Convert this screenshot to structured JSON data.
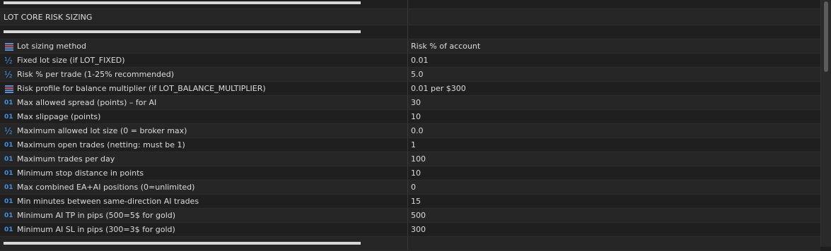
{
  "section": {
    "title": "LOT CORE RISK SIZING"
  },
  "params": [
    {
      "icon": "list-icon",
      "name": "Lot sizing method",
      "value": "Risk % of account"
    },
    {
      "icon": "fraction-icon",
      "name": "Fixed lot size (if LOT_FIXED)",
      "value": "0.01"
    },
    {
      "icon": "fraction-icon",
      "name": "Risk % per trade (1-25% recommended)",
      "value": "5.0"
    },
    {
      "icon": "list-icon",
      "name": "Risk profile for balance multiplier (if LOT_BALANCE_MULTIPLIER)",
      "value": "0.01 per $300"
    },
    {
      "icon": "integer-icon",
      "name": "Max allowed spread (points) – for AI",
      "value": "30"
    },
    {
      "icon": "integer-icon",
      "name": "Max slippage (points)",
      "value": "10"
    },
    {
      "icon": "fraction-icon",
      "name": "Maximum allowed lot size (0 = broker max)",
      "value": "0.0"
    },
    {
      "icon": "integer-icon",
      "name": "Maximum open trades (netting: must be 1)",
      "value": "1"
    },
    {
      "icon": "integer-icon",
      "name": "Maximum trades per day",
      "value": "100"
    },
    {
      "icon": "integer-icon",
      "name": "Minimum stop distance in points",
      "value": "10"
    },
    {
      "icon": "integer-icon",
      "name": "Max combined EA+AI positions (0=unlimited)",
      "value": "0"
    },
    {
      "icon": "integer-icon",
      "name": "Min minutes between same-direction AI trades",
      "value": "15"
    },
    {
      "icon": "integer-icon",
      "name": "Minimum AI TP in pips (500=5$ for gold)",
      "value": "500"
    },
    {
      "icon": "integer-icon",
      "name": "Minimum AI SL in pips (300=3$ for gold)",
      "value": "300"
    }
  ],
  "glyphs": {
    "integer": "01",
    "fraction": "½"
  },
  "colors": {
    "accent": "#4a8fe0",
    "list_icon_red": "#d9534f",
    "list_icon_blue": "#5b8fd6",
    "separator": "#d8d8d8"
  }
}
